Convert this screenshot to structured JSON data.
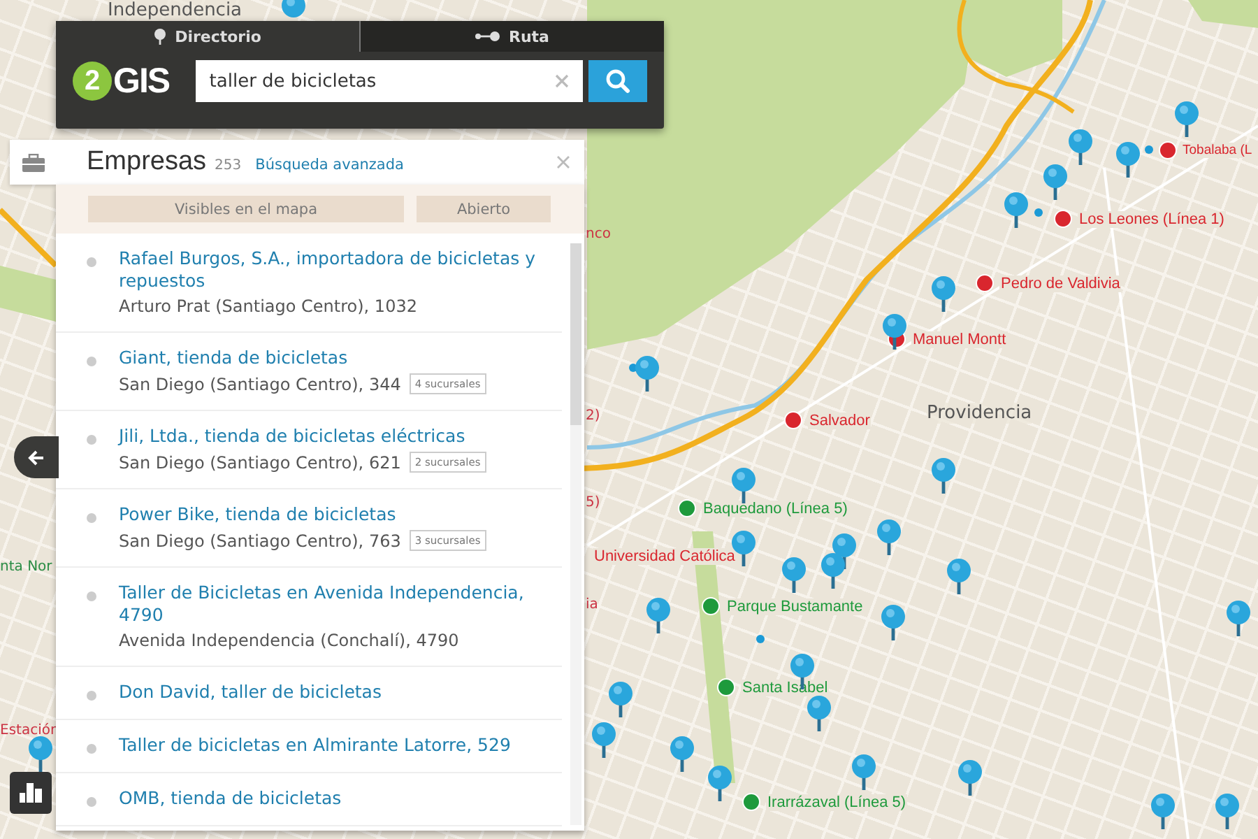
{
  "search_bar": {
    "tabs": [
      {
        "label": "Directorio",
        "selected": true
      },
      {
        "label": "Ruta",
        "selected": false
      }
    ],
    "logo": {
      "mark": "2",
      "text": "GIS"
    },
    "search": {
      "value": "taller de bicicletas"
    }
  },
  "results": {
    "title": "Empresas",
    "count": "253",
    "advanced_link": "Búsqueda avanzada",
    "filters": [
      "Visibles en el mapa",
      "Abierto"
    ],
    "items": [
      {
        "name": "Rafael Burgos, S.A., importadora de bicicletas y repuestos",
        "address": "Arturo Prat (Santiago Centro), 1032"
      },
      {
        "name": "Giant, tienda de bicicletas",
        "address": "San Diego (Santiago Centro), 344",
        "branches": "4 sucursales"
      },
      {
        "name": "Jili, Ltda., tienda de bicicletas eléctricas",
        "address": "San Diego (Santiago Centro), 621",
        "branches": "2 sucursales"
      },
      {
        "name": "Power Bike, tienda de bicicletas",
        "address": "San Diego (Santiago Centro), 763",
        "branches": "3 sucursales"
      },
      {
        "name": "Taller de Bicicletas en Avenida Independencia, 4790",
        "address": "Avenida Independencia (Conchalí), 4790"
      },
      {
        "name": "Don David, taller de bicicletas"
      },
      {
        "name": "Taller de bicicletas en Almirante Latorre, 529"
      },
      {
        "name": "OMB, tienda de bicicletas"
      }
    ]
  },
  "map": {
    "district_labels": [
      "Independencia",
      "Providencia",
      "nta Nor",
      "Estación"
    ],
    "edge_labels": [
      "nco",
      "2)",
      "5)",
      "ia"
    ],
    "stations": [
      {
        "name": "Tobalaba (L",
        "color": "#d9262e"
      },
      {
        "name": "Los Leones (Línea 1)",
        "color": "#d9262e"
      },
      {
        "name": "Pedro de Valdivia",
        "color": "#d9262e"
      },
      {
        "name": "Manuel Montt",
        "color": "#d9262e"
      },
      {
        "name": "Salvador",
        "color": "#d9262e"
      },
      {
        "name": "Baquedano (Línea 5)",
        "color": "#1e9a3c"
      },
      {
        "name": "Universidad Católica",
        "color": "#d9262e"
      },
      {
        "name": "Parque Bustamante",
        "color": "#1e9a3c"
      },
      {
        "name": "Santa Isabel",
        "color": "#1e9a3c"
      },
      {
        "name": "Irarrázaval (Línea 5)",
        "color": "#1e9a3c"
      }
    ]
  }
}
